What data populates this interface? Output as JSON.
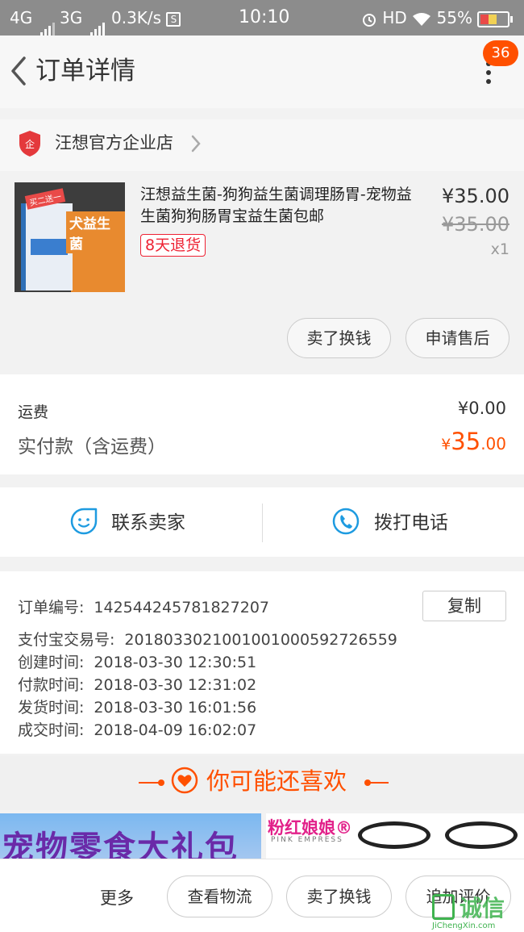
{
  "status_bar": {
    "net1": "4G",
    "net2": "3G",
    "speed": "0.3K/s",
    "s_icon": "S",
    "time": "10:10",
    "hd": "HD",
    "battery": "55%"
  },
  "header": {
    "title": "订单详情",
    "notification_count": "36"
  },
  "shop": {
    "logo_char": "企",
    "name": "汪想官方企业店"
  },
  "product": {
    "name": "汪想益生菌-狗狗益生菌调理肠胃-宠物益生菌狗狗肠胃宝益生菌包邮",
    "return_tag": "8天退货",
    "price": "¥35.00",
    "original_price": "¥35.00",
    "quantity": "x1",
    "image_label": "犬益生菌",
    "image_tag": "买二送一",
    "buttons": {
      "sell_for_cash": "卖了换钱",
      "after_sales": "申请售后"
    }
  },
  "fees": {
    "shipping_label": "运费",
    "shipping_value": "¥0.00",
    "paid_label": "实付款（含运费）",
    "paid_currency": "¥",
    "paid_int": "35",
    "paid_dec": ".00"
  },
  "contact": {
    "seller_label": "联系卖家",
    "call_label": "拨打电话"
  },
  "order_info": {
    "copy_button": "复制",
    "rows": [
      {
        "key": "订单编号:",
        "value": "142544245781827207"
      },
      {
        "key": "支付宝交易号:",
        "value": "2018033021001001000592726559"
      },
      {
        "key": "创建时间:",
        "value": "2018-03-30 12:30:51"
      },
      {
        "key": "付款时间:",
        "value": "2018-03-30 12:31:02"
      },
      {
        "key": "发货时间:",
        "value": "2018-03-30 16:01:56"
      },
      {
        "key": "成交时间:",
        "value": "2018-04-09 16:02:07"
      }
    ]
  },
  "recommend": {
    "title": "你可能还喜欢"
  },
  "banners": {
    "pet_snacks": "宠物零食大礼包",
    "brand": "粉红娘娘®",
    "brand_sub": "PINK EMPRESS"
  },
  "bottom_bar": {
    "more": "更多",
    "view_logistics": "查看物流",
    "sell_for_cash": "卖了换钱",
    "add_review": "追加评价"
  },
  "watermark": {
    "text": "诚信",
    "url": "JiChengXin.com"
  },
  "colors": {
    "accent": "#ff5000",
    "icon_blue": "#1e9be0",
    "shop_red": "#e4393c"
  }
}
